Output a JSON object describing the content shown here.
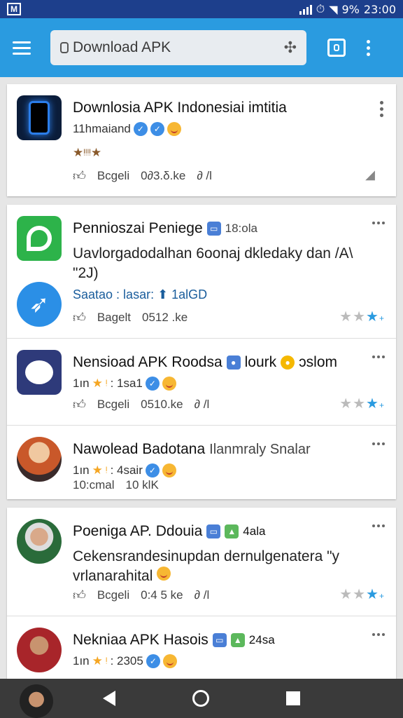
{
  "status_bar": {
    "battery": "9%",
    "time": "23:00"
  },
  "app_bar": {
    "search_text": "Download APK"
  },
  "posts": [
    {
      "title": "Downlosia APK Indonesiai imtitia",
      "sub": "11hmaiand",
      "stars": "★ᵎᵎᵎᵎ★",
      "like": "Bcgeli",
      "views": "0∂3.δ.ke",
      "share": "∂ /l"
    },
    {
      "title": "Pennioszai Peniege",
      "tag": "18:ola",
      "body": "Uavlorgadodalhan 6oonaj dkledaky dan /A\\ \"2J)",
      "link": "Saatao : lasar: ⬆ 1alGD",
      "like": "Bagelt",
      "views": "0512 .ke"
    },
    {
      "title": "Nensioad APK Roodsa",
      "tag1": "lourk",
      "tag2": "ɔslom",
      "sub": "1ın",
      "sub2": ": 1sa1",
      "like": "Bcgeli",
      "views": "0510.ke",
      "share": "∂ /l"
    },
    {
      "title": "Nawolead Badotana",
      "tag": "Ilanmraly Snalar",
      "sub": "1ın",
      "sub2": ": 4sair",
      "like": "10:cmal",
      "views": "10 klK"
    },
    {
      "title": "Poeniga AP. Ddouia",
      "tag": "4ala",
      "body": "Cekensrandesinupdan dernulgenatera \"y vrlanarahital",
      "like": "Bcgeli",
      "views": "0:4 5 ke",
      "share": "∂ /l"
    },
    {
      "title": "Nekniaa APK Hasois",
      "tag": "24sa",
      "sub": "1ın",
      "sub2": ": 2305"
    }
  ]
}
